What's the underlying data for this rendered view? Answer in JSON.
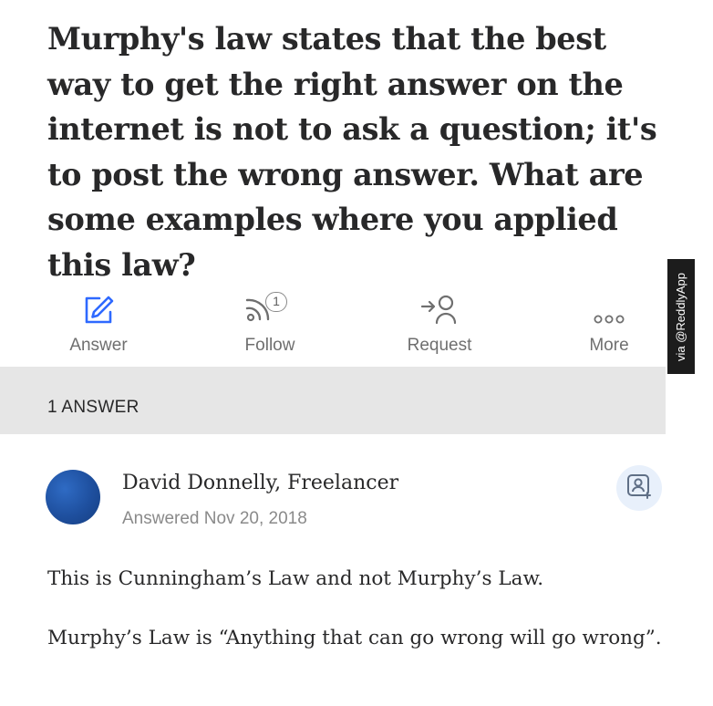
{
  "question": {
    "title": "Murphy's law states that the best way to get the right answer on the internet is not to ask a question; it's to post the wrong answer. What are some examples where you applied this law?"
  },
  "actions": {
    "answer_label": "Answer",
    "follow_label": "Follow",
    "follow_count": "1",
    "request_label": "Request",
    "more_label": "More"
  },
  "watermark": "via @ReddlyApp",
  "answers_header": "1 ANSWER",
  "answer": {
    "author": "David Donnelly, Freelancer",
    "date": "Answered Nov 20, 2018",
    "paragraphs": [
      "This is Cunningham’s Law and not Murphy’s Law.",
      "Murphy’s Law is “Anything that can go wrong will go wrong”."
    ]
  },
  "colors": {
    "answer_icon": "#2e69ff",
    "watermark_bg": "#1c1c1c",
    "section_bg": "#e6e6e6",
    "avatar": "#1e4f9e"
  },
  "icons": {
    "answer": "pencil-square-icon",
    "follow": "rss-icon",
    "request": "add-person-icon",
    "more": "ellipsis-icon",
    "profile": "person-add-icon"
  }
}
